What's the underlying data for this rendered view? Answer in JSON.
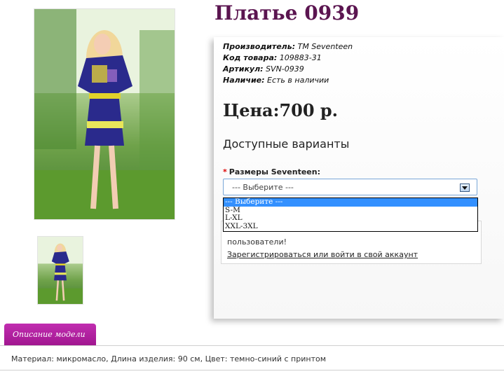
{
  "product": {
    "title": "Платье 0939",
    "manufacturer_label": "Производитель:",
    "manufacturer_value": "TM Seventeen",
    "code_label": "Код товара:",
    "code_value": "109883-31",
    "article_label": "Артикул:",
    "article_value": "SVN-0939",
    "availability_label": "Наличие:",
    "availability_value": "Есть в наличии",
    "price": "Цена:700 р."
  },
  "options": {
    "title": "Доступные варианты",
    "required_mark": "*",
    "size_label": "Размеры Seventeen:",
    "select_value": "--- Выберите ---",
    "dropdown_options": [
      "--- Выберите ---",
      "S-M",
      "L-XL",
      "XXL-3XL"
    ]
  },
  "notice": {
    "text": "пользователи!",
    "link": "Зарегистрироваться или войти в свой аккаунт"
  },
  "tabs": {
    "description_tab": "Описание модели"
  },
  "description": {
    "text": "Материал: микромасло, Длина изделия: 90 см, Цвет: темно-синий с принтом"
  },
  "colors": {
    "title_purple": "#5b1550",
    "tab_magenta": "#b01f9f",
    "select_highlight": "#3390ff",
    "required_red": "#dd0000"
  },
  "icons": {
    "dropdown": "chevron-down-icon"
  }
}
